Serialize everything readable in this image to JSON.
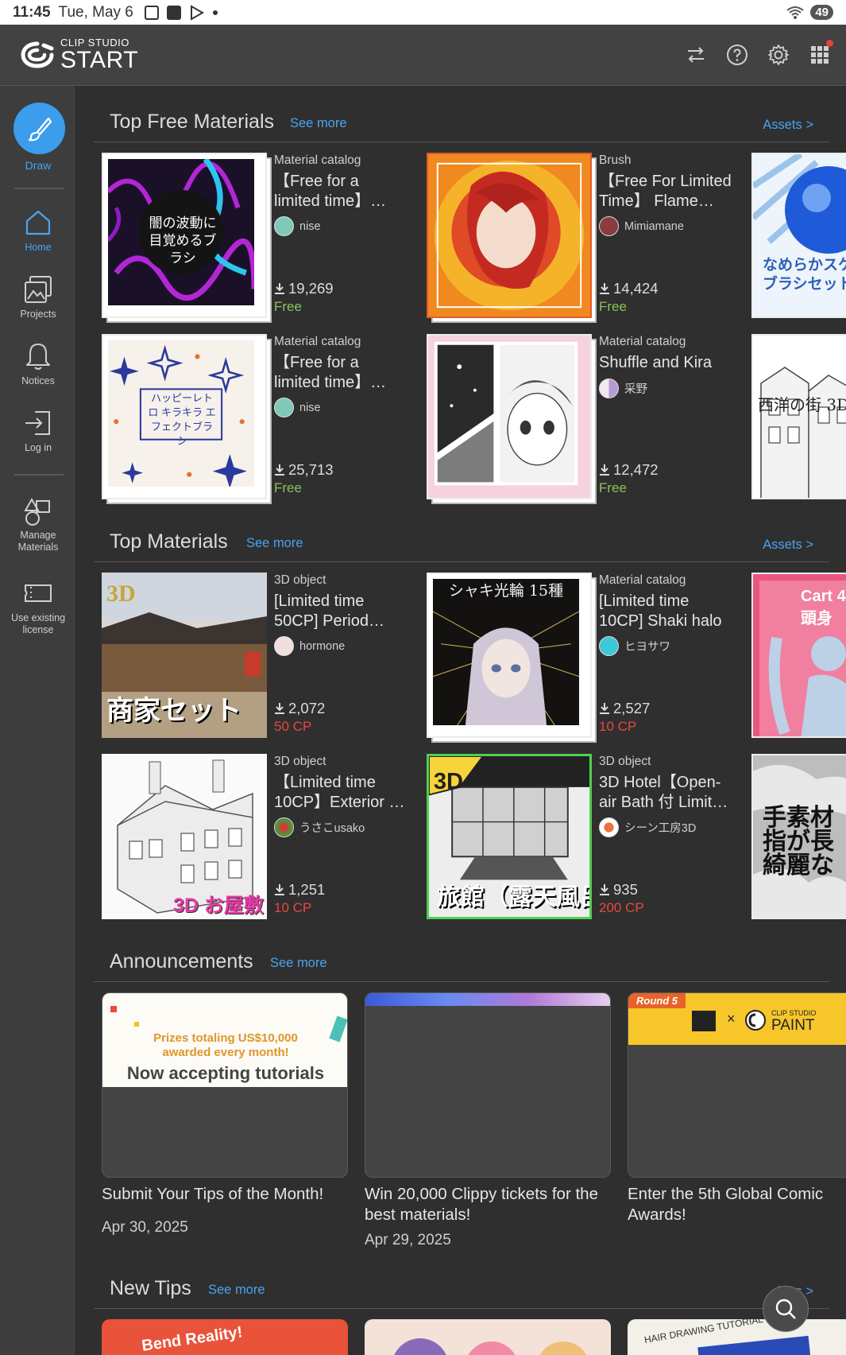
{
  "status": {
    "time": "11:45",
    "date": "Tue, May 6",
    "battery": "49"
  },
  "app": {
    "logo_small": "CLIP STUDIO",
    "logo_big": "START"
  },
  "sidebar": {
    "draw_label": "Draw",
    "items": [
      {
        "label": "Home",
        "icon": "home-icon"
      },
      {
        "label": "Projects",
        "icon": "projects-icon"
      },
      {
        "label": "Notices",
        "icon": "bell-icon"
      },
      {
        "label": "Log in",
        "icon": "login-icon"
      },
      {
        "label": "Manage Materials",
        "icon": "shapes-icon"
      },
      {
        "label": "Use existing license",
        "icon": "ticket-icon"
      }
    ]
  },
  "sections": {
    "free": {
      "title": "Top Free Materials",
      "see_more": "See more",
      "link": "Assets >"
    },
    "top": {
      "title": "Top Materials",
      "see_more": "See more",
      "link": "Assets >"
    },
    "announcements": {
      "title": "Announcements",
      "see_more": "See more"
    },
    "tips": {
      "title": "New Tips",
      "see_more": "See more",
      "link": "Tips >"
    }
  },
  "free_materials": [
    {
      "category": "Material catalog",
      "title": "【Free for a limited time】…",
      "author": "nise",
      "downloads": "19,269",
      "price": "Free",
      "thumb_text": "闇の波動に目覚めるブラシ"
    },
    {
      "category": "Brush",
      "title": "【Free For Limited Time】 Flame…",
      "author": "Mimiamane",
      "downloads": "14,424",
      "price": "Free"
    },
    {
      "category": "Material catalog",
      "title": "【Free for a limited time】…",
      "author": "nise",
      "downloads": "25,713",
      "price": "Free",
      "thumb_text": "ハッピーレトロ キラキラ エフェクトブラシ"
    },
    {
      "category": "Material catalog",
      "title": "Shuffle and Kira",
      "author": "采野",
      "downloads": "12,472",
      "price": "Free"
    }
  ],
  "free_partial": [
    {
      "thumb_text": "なめらかスケ ブラシセット"
    },
    {
      "thumb_text": "西洋の街 3D"
    }
  ],
  "top_materials": [
    {
      "category": "3D object",
      "title": "[Limited time 50CP] Period…",
      "author": "hormone",
      "downloads": "2,072",
      "price": "50 CP",
      "thumb_text": "商家セット"
    },
    {
      "category": "Material catalog",
      "title": "[Limited time 10CP] Shaki halo",
      "author": "ヒヨサワ",
      "downloads": "2,527",
      "price": "10 CP",
      "thumb_text": "シャキ光輪 15種"
    },
    {
      "category": "3D object",
      "title": "【Limited time 10CP】Exterior …",
      "author": "うさこusako",
      "downloads": "1,251",
      "price": "10 CP",
      "thumb_text": "3D お屋敷"
    },
    {
      "category": "3D object",
      "title": "3D Hotel【Open-air Bath 付 Limit…",
      "author": "シーン工房3D",
      "downloads": "935",
      "price": "200 CP",
      "thumb_text": "旅館（露天風呂付）"
    }
  ],
  "top_partial": [
    {
      "thumb_text": "Cart 4頭身"
    },
    {
      "thumb_text": "手素材 指が長 綺麗な"
    }
  ],
  "announcements": [
    {
      "title": "Submit Your Tips of the Month!",
      "date": "Apr 30, 2025",
      "banner_line1": "Prizes totaling US$10,000",
      "banner_line2": "awarded every month!",
      "banner_line3": "Now accepting tutorials"
    },
    {
      "title": "Win 20,000 Clippy tickets for the best materials!",
      "date": "Apr 29, 2025"
    },
    {
      "title": "Enter the 5th Global Comic Awards!",
      "banner_round": "Round 5",
      "banner_paint": "PAINT",
      "banner_cs": "CLIP STUDIO"
    }
  ],
  "tips_thumbs": [
    {
      "text": "Bend Reality!"
    },
    {
      "text": ""
    },
    {
      "text": "HAIR DRAWING TUTORIAL"
    }
  ]
}
